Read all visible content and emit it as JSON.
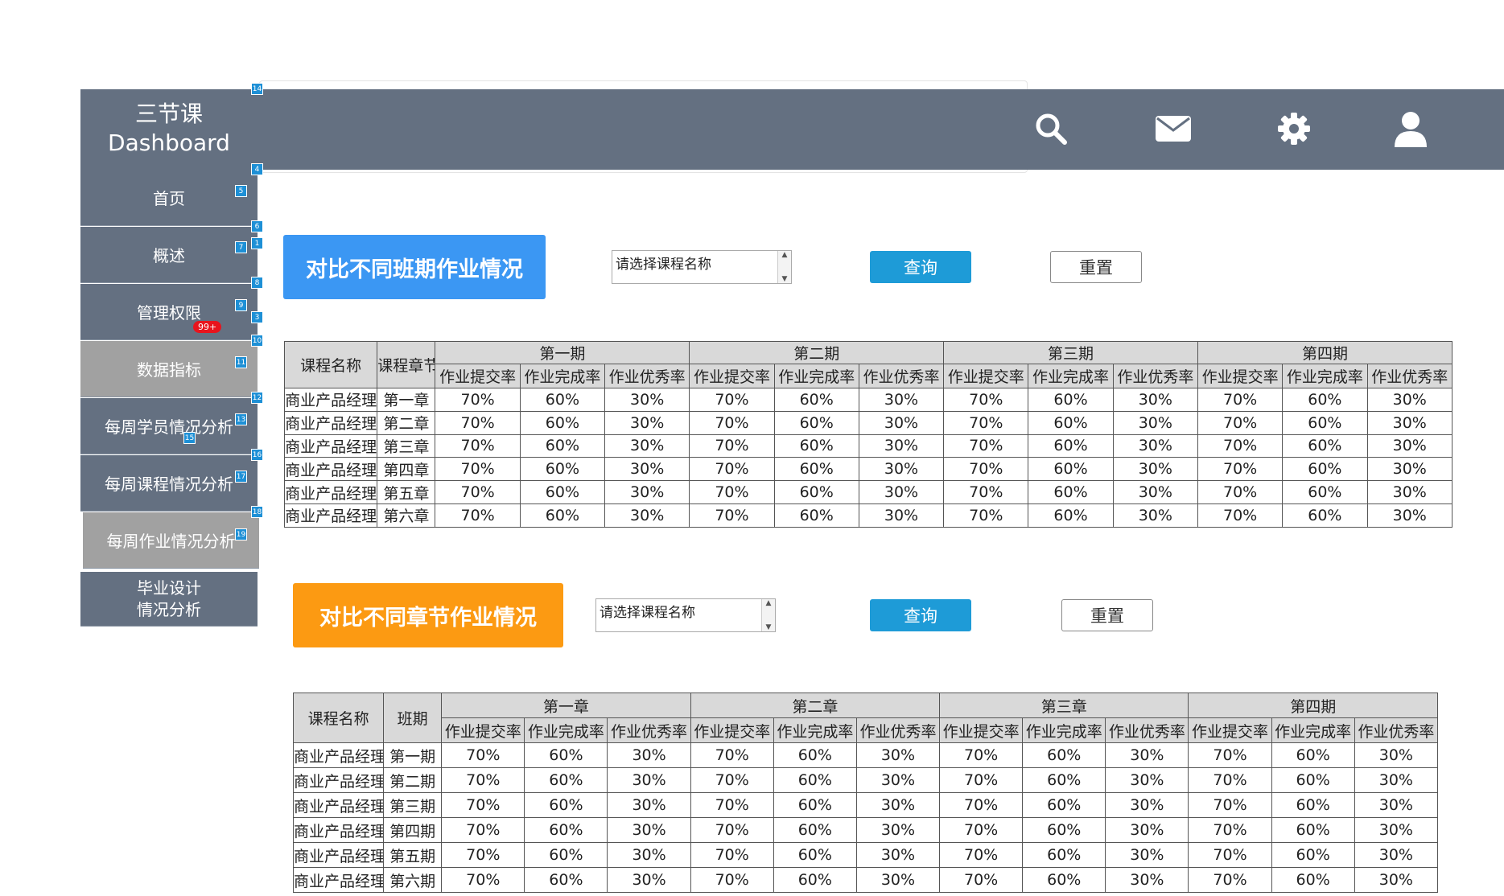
{
  "app": {
    "brand_line1": "三节课",
    "brand_line2": "Dashboard"
  },
  "header": {
    "icons": [
      "search-icon",
      "mail-icon",
      "gear-icon",
      "user-icon"
    ]
  },
  "sidebar": {
    "items": [
      {
        "label": "首页"
      },
      {
        "label": "概述"
      },
      {
        "label": "管理权限",
        "badge": "99+"
      },
      {
        "label": "数据指标"
      },
      {
        "label": "每周学员情况分析"
      },
      {
        "label": "每周课程情况分析"
      },
      {
        "label": "每周作业情况分析"
      },
      {
        "label_line1": "毕业设计",
        "label_line2": "情况分析"
      }
    ]
  },
  "annotation_tags": [
    "14",
    "4",
    "5",
    "6",
    "1",
    "7",
    "8",
    "9",
    "3",
    "10",
    "11",
    "12",
    "13",
    "15",
    "16",
    "17",
    "18",
    "19"
  ],
  "section1": {
    "title": "对比不同班期作业情况",
    "select_placeholder": "请选择课程名称",
    "query_label": "查询",
    "reset_label": "重置",
    "table": {
      "col1": "课程名称",
      "col2": "课程章节",
      "groups": [
        "第一期",
        "第二期",
        "第三期",
        "第四期"
      ],
      "metrics": [
        "作业提交率",
        "作业完成率",
        "作业优秀率"
      ],
      "rows": [
        {
          "course": "商业产品经理",
          "key": "第一章",
          "values": [
            "70%",
            "60%",
            "30%",
            "70%",
            "60%",
            "30%",
            "70%",
            "60%",
            "30%",
            "70%",
            "60%",
            "30%"
          ]
        },
        {
          "course": "商业产品经理",
          "key": "第二章",
          "values": [
            "70%",
            "60%",
            "30%",
            "70%",
            "60%",
            "30%",
            "70%",
            "60%",
            "30%",
            "70%",
            "60%",
            "30%"
          ]
        },
        {
          "course": "商业产品经理",
          "key": "第三章",
          "values": [
            "70%",
            "60%",
            "30%",
            "70%",
            "60%",
            "30%",
            "70%",
            "60%",
            "30%",
            "70%",
            "60%",
            "30%"
          ]
        },
        {
          "course": "商业产品经理",
          "key": "第四章",
          "values": [
            "70%",
            "60%",
            "30%",
            "70%",
            "60%",
            "30%",
            "70%",
            "60%",
            "30%",
            "70%",
            "60%",
            "30%"
          ]
        },
        {
          "course": "商业产品经理",
          "key": "第五章",
          "values": [
            "70%",
            "60%",
            "30%",
            "70%",
            "60%",
            "30%",
            "70%",
            "60%",
            "30%",
            "70%",
            "60%",
            "30%"
          ]
        },
        {
          "course": "商业产品经理",
          "key": "第六章",
          "values": [
            "70%",
            "60%",
            "30%",
            "70%",
            "60%",
            "30%",
            "70%",
            "60%",
            "30%",
            "70%",
            "60%",
            "30%"
          ]
        }
      ]
    }
  },
  "section2": {
    "title": "对比不同章节作业情况",
    "select_placeholder": "请选择课程名称",
    "query_label": "查询",
    "reset_label": "重置",
    "table": {
      "col1": "课程名称",
      "col2": "班期",
      "groups": [
        "第一章",
        "第二章",
        "第三章",
        "第四期"
      ],
      "metrics": [
        "作业提交率",
        "作业完成率",
        "作业优秀率"
      ],
      "rows": [
        {
          "course": "商业产品经理",
          "key": "第一期",
          "values": [
            "70%",
            "60%",
            "30%",
            "70%",
            "60%",
            "30%",
            "70%",
            "60%",
            "30%",
            "70%",
            "60%",
            "30%"
          ]
        },
        {
          "course": "商业产品经理",
          "key": "第二期",
          "values": [
            "70%",
            "60%",
            "30%",
            "70%",
            "60%",
            "30%",
            "70%",
            "60%",
            "30%",
            "70%",
            "60%",
            "30%"
          ]
        },
        {
          "course": "商业产品经理",
          "key": "第三期",
          "values": [
            "70%",
            "60%",
            "30%",
            "70%",
            "60%",
            "30%",
            "70%",
            "60%",
            "30%",
            "70%",
            "60%",
            "30%"
          ]
        },
        {
          "course": "商业产品经理",
          "key": "第四期",
          "values": [
            "70%",
            "60%",
            "30%",
            "70%",
            "60%",
            "30%",
            "70%",
            "60%",
            "30%",
            "70%",
            "60%",
            "30%"
          ]
        },
        {
          "course": "商业产品经理",
          "key": "第五期",
          "values": [
            "70%",
            "60%",
            "30%",
            "70%",
            "60%",
            "30%",
            "70%",
            "60%",
            "30%",
            "70%",
            "60%",
            "30%"
          ]
        },
        {
          "course": "商业产品经理",
          "key": "第六期",
          "values": [
            "70%",
            "60%",
            "30%",
            "70%",
            "60%",
            "30%",
            "70%",
            "60%",
            "30%",
            "70%",
            "60%",
            "30%"
          ]
        }
      ]
    }
  }
}
